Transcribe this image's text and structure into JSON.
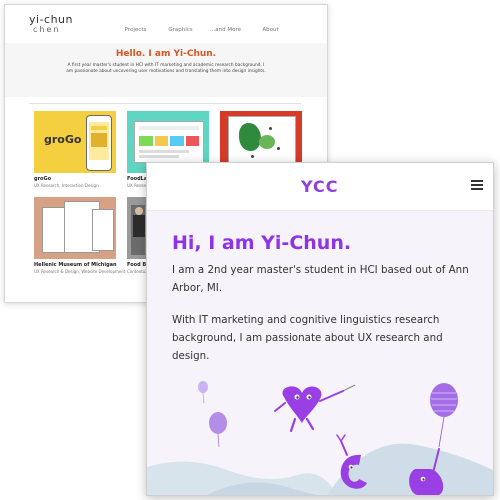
{
  "back_window": {
    "logo_line1": "yi-chun",
    "logo_line2": "chen",
    "nav": [
      "Projects",
      "Graphics",
      "...and More",
      "About"
    ],
    "hero_title": "Hello. I am Yi-Chun.",
    "hero_text": "A first year master's student in HCI with IT marketing and academic research background, I am passionate about uncovering user motivations and translating them into design insights.",
    "projects": [
      {
        "title": "groGo",
        "subtitle": "UX Research, Interaction Design",
        "image_text": "groGo"
      },
      {
        "title": "FoodLabs Feed",
        "subtitle": "UX Research"
      },
      {
        "title": "",
        "subtitle": ""
      },
      {
        "title": "Hellenic Museum of Michigan",
        "subtitle": "UX Research & Design, Website Development"
      },
      {
        "title": "Food Bank",
        "subtitle": "Contextual Inq"
      }
    ]
  },
  "front_window": {
    "logo": "YCC",
    "menu_icon": "hamburger-icon",
    "title": "Hi, I am Yi-Chun.",
    "intro": "I am a 2nd year master's student in HCI based out of Ann Arbor, MI.",
    "body": "With IT marketing and cognitive linguistics research background, I am passionate about UX research and design."
  },
  "colors": {
    "accent_purple": "#8e33ea",
    "back_accent_orange": "#d9541e",
    "front_bg": "#f6f3fb"
  }
}
